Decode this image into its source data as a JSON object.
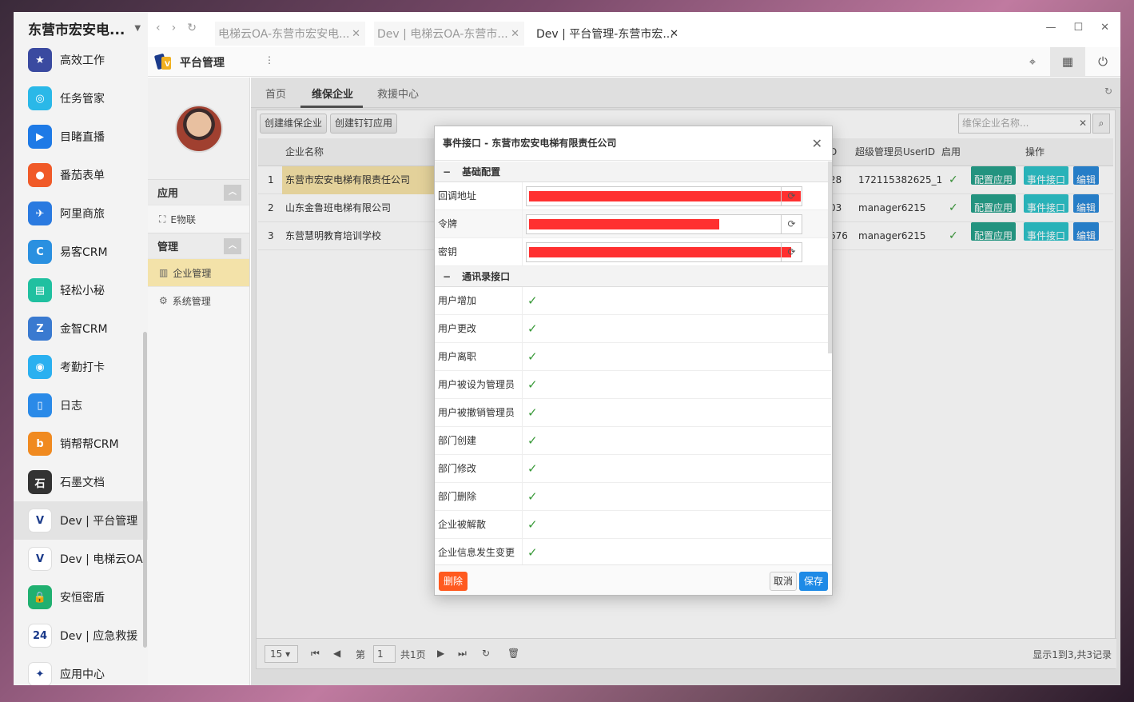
{
  "dock": {
    "org_name": "东营市宏安电...",
    "apps": [
      {
        "label": "高效工作",
        "icon": "star-badge-icon",
        "color": "#3a4aa0",
        "glyph": "★"
      },
      {
        "label": "任务管家",
        "icon": "task-icon",
        "color": "#2ab8e8",
        "glyph": "◎"
      },
      {
        "label": "目睹直播",
        "icon": "play-icon",
        "color": "#1e7ae6",
        "glyph": "▶"
      },
      {
        "label": "番茄表单",
        "icon": "tomato-icon",
        "color": "#f05a28",
        "glyph": "●"
      },
      {
        "label": "阿里商旅",
        "icon": "plane-icon",
        "color": "#2a7ae0",
        "glyph": "✈"
      },
      {
        "label": "易客CRM",
        "icon": "crm-icon",
        "color": "#2a90e0",
        "glyph": "C"
      },
      {
        "label": "轻松小秘",
        "icon": "notepad-icon",
        "color": "#20c0a0",
        "glyph": "▤"
      },
      {
        "label": "金智CRM",
        "icon": "jinzhi-icon",
        "color": "#3a7ad0",
        "glyph": "Z"
      },
      {
        "label": "考勤打卡",
        "icon": "location-icon",
        "color": "#2ab0f0",
        "glyph": "◉"
      },
      {
        "label": "日志",
        "icon": "journal-icon",
        "color": "#2a8ae8",
        "glyph": "▯"
      },
      {
        "label": "销帮帮CRM",
        "icon": "xbb-icon",
        "color": "#f08a20",
        "glyph": "b"
      },
      {
        "label": "石墨文档",
        "icon": "shimo-icon",
        "color": "#333333",
        "glyph": "石"
      },
      {
        "label": "Dev | 平台管理",
        "icon": "platform-logo-icon",
        "color": "#ffffff",
        "glyph": "V",
        "active": true
      },
      {
        "label": "Dev | 电梯云OA",
        "icon": "elevator-logo-icon",
        "color": "#ffffff",
        "glyph": "V"
      },
      {
        "label": "安恒密盾",
        "icon": "lock-icon",
        "color": "#20b070",
        "glyph": "🔒"
      },
      {
        "label": "Dev | 应急救援",
        "icon": "rescue-24-icon",
        "color": "#ffffff",
        "glyph": "24"
      },
      {
        "label": "应用中心",
        "icon": "app-center-icon",
        "color": "#ffffff",
        "glyph": "✦"
      }
    ]
  },
  "browser": {
    "tabs": [
      {
        "label": "电梯云OA-东营市宏安电..."
      },
      {
        "label": "Dev | 电梯云OA-东营市..."
      },
      {
        "label": "Dev | 平台管理-东营市宏..."
      }
    ]
  },
  "header": {
    "title": "平台管理"
  },
  "sidebar": {
    "group1": "应用",
    "group1_items": [
      "E物联"
    ],
    "group2": "管理",
    "group2_items": [
      "企业管理",
      "系统管理"
    ]
  },
  "main": {
    "tabs": [
      "首页",
      "维保企业",
      "救援中心"
    ],
    "toolbar": {
      "create_company": "创建维保企业",
      "create_dingtalk": "创建钉钉应用"
    },
    "search_placeholder": "维保企业名称...",
    "columns": {
      "name": "企业名称",
      "id_tail": "D",
      "super_admin": "超级管理员UserID",
      "enabled": "启用",
      "ops": "操作"
    },
    "rows": [
      {
        "no": "1",
        "name": "东营市宏安电梯有限责任公司",
        "id_tail": "28",
        "admin": "172115382625_1"
      },
      {
        "no": "2",
        "name": "山东金鲁班电梯有限公司",
        "id_tail": "03",
        "admin": "manager6215"
      },
      {
        "no": "3",
        "name": "东营慧明教育培训学校",
        "id_tail": "676",
        "admin": "manager6215"
      }
    ],
    "row_actions": {
      "config": "配置应用",
      "event": "事件接口",
      "edit": "编辑"
    },
    "pager": {
      "size": "15",
      "page_prefix": "第",
      "page": "1",
      "total_pages": "共1页",
      "summary": "显示1到3,共3记录"
    }
  },
  "dialog": {
    "title": "事件接口 - 东营市宏安电梯有限责任公司",
    "section_basic": "基础配置",
    "fields": [
      "回调地址",
      "令牌",
      "密钥"
    ],
    "section_contacts": "通讯录接口",
    "events": [
      "用户增加",
      "用户更改",
      "用户离职",
      "用户被设为管理员",
      "用户被撤销管理员",
      "部门创建",
      "部门修改",
      "部门删除",
      "企业被解散",
      "企业信息发生变更"
    ],
    "delete": "删除",
    "cancel": "取消",
    "save": "保存"
  }
}
